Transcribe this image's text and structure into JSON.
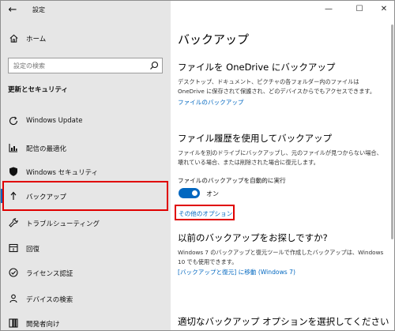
{
  "window": {
    "title": "設定",
    "controls": {
      "minimize": "—",
      "maximize": "☐",
      "close": "✕"
    }
  },
  "sidebar": {
    "back": "←",
    "home_label": "ホーム",
    "search_placeholder": "設定の検索",
    "section_title": "更新とセキュリティ",
    "items": [
      {
        "label": "Windows Update",
        "icon": "refresh-icon"
      },
      {
        "label": "配信の最適化",
        "icon": "delivery-optimization-icon"
      },
      {
        "label": "Windows セキュリティ",
        "icon": "shield-icon"
      },
      {
        "label": "バックアップ",
        "icon": "backup-icon",
        "selected": true
      },
      {
        "label": "トラブルシューティング",
        "icon": "wrench-icon"
      },
      {
        "label": "回復",
        "icon": "recovery-icon"
      },
      {
        "label": "ライセンス認証",
        "icon": "check-circle-icon"
      },
      {
        "label": "デバイスの検索",
        "icon": "person-pin-icon"
      },
      {
        "label": "開発者向け",
        "icon": "developer-icon"
      }
    ]
  },
  "main": {
    "title": "バックアップ",
    "onedrive": {
      "heading": "ファイルを OneDrive にバックアップ",
      "desc": "デスクトップ、ドキュメント、ピクチャの各フォルダー内のファイルは OneDrive に保存されて保護され、どのデバイスからでもアクセスできます。",
      "link": "ファイルのバックアップ"
    },
    "history": {
      "heading": "ファイル履歴を使用してバックアップ",
      "desc": "ファイルを別のドライブにバックアップし、元のファイルが見つからない場合、壊れている場合、または削除された場合に復元します。",
      "toggle_label": "ファイルのバックアップを自動的に実行",
      "toggle_state": "オン",
      "options_link": "その他のオプション"
    },
    "older": {
      "heading": "以前のバックアップをお探しですか?",
      "desc": "Windows 7 のバックアップと復元ツールで作成したバックアップは、Windows 10 でも使用できます。",
      "link": "[バックアップと復元] に移動 (Windows 7)"
    },
    "bottom_heading": "適切なバックアップ オプションを選択してください"
  },
  "colors": {
    "accent": "#0067c0",
    "highlight": "#e00000",
    "sidebar_bg": "#e6e6e6"
  }
}
